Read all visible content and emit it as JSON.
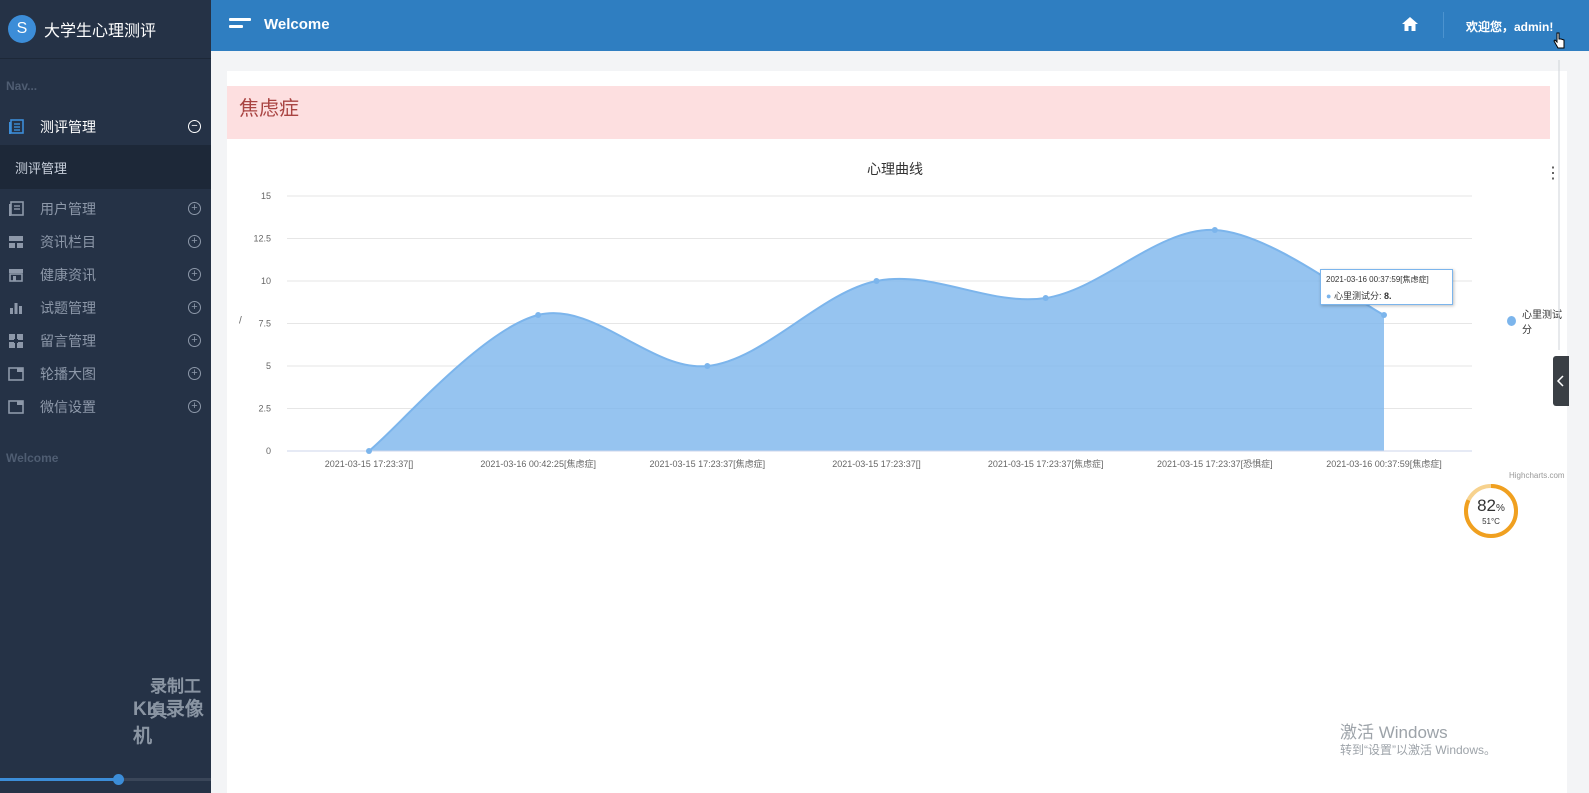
{
  "brand": {
    "logo_letter": "S",
    "title": "大学生心理测评"
  },
  "sidebar": {
    "section_label": "Nav...",
    "active_item": {
      "label": "测评管理",
      "icon": "document-icon"
    },
    "submenu_label": "测评管理",
    "items": [
      {
        "label": "用户管理",
        "icon": "document-icon"
      },
      {
        "label": "资讯栏目",
        "icon": "layout-icon"
      },
      {
        "label": "健康资讯",
        "icon": "store-icon"
      },
      {
        "label": "试题管理",
        "icon": "bar-chart-icon"
      },
      {
        "label": "留言管理",
        "icon": "grid-icon"
      },
      {
        "label": "轮播大图",
        "icon": "window-icon"
      },
      {
        "label": "微信设置",
        "icon": "window-icon"
      }
    ],
    "footer_label": "Welcome",
    "progress": 0.56
  },
  "watermark": {
    "line1": "录制工具",
    "line2": "KK 录像机"
  },
  "topbar": {
    "title": "Welcome",
    "user_text": "欢迎您，admin!"
  },
  "alert": {
    "text": "焦虑症"
  },
  "chart_data": {
    "type": "area",
    "title": "心理曲线",
    "ylabel": "/",
    "categories": [
      "2021-03-15 17:23:37[]",
      "2021-03-16 00:42:25[焦虑症]",
      "2021-03-15 17:23:37[焦虑症]",
      "2021-03-15 17:23:37[]",
      "2021-03-15 17:23:37[焦虑症]",
      "2021-03-15 17:23:37[恐惧症]",
      "2021-03-16 00:37:59[焦虑症]"
    ],
    "series": [
      {
        "name": "心里测试分",
        "values": [
          0,
          8,
          5,
          10,
          9,
          13,
          8
        ]
      }
    ],
    "yticks": [
      "0",
      "2.5",
      "5",
      "7.5",
      "10",
      "12.5",
      "15"
    ],
    "ylim": [
      0,
      15
    ],
    "grid": true,
    "legend": "right",
    "tooltip": {
      "title": "2021-03-16 00:37:59[焦虑症]",
      "label": "心里测试分: ",
      "value": "8."
    },
    "credits": "Highcharts.com",
    "color": "#7cb5ec"
  },
  "gauge": {
    "percent": "82",
    "unit": "%",
    "temp": "51°C"
  },
  "os_watermark": {
    "line1": "激活 Windows",
    "line2": "转到“设置”以激活 Windows。"
  }
}
